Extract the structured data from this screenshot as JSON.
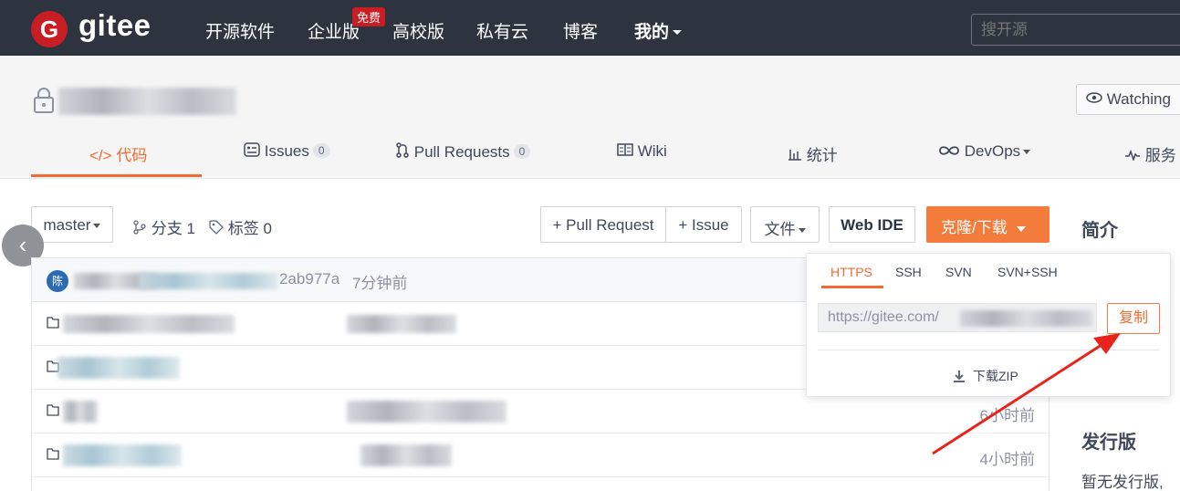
{
  "brand": {
    "logo_letter": "G",
    "name": "gitee",
    "accent": "#c71d23",
    "primary": "#f36b31"
  },
  "topnav": {
    "items": [
      "开源软件",
      "企业版",
      "高校版",
      "私有云",
      "博客",
      "我的"
    ],
    "badge": "免费",
    "search_placeholder": "搜开源"
  },
  "repo": {
    "watch_label": "Watching",
    "tabs": [
      {
        "icon": "code-icon",
        "label": "代码"
      },
      {
        "icon": "issues-icon",
        "label": "Issues",
        "count": "0"
      },
      {
        "icon": "pull-request-icon",
        "label": "Pull Requests",
        "count": "0"
      },
      {
        "icon": "wiki-icon",
        "label": "Wiki"
      },
      {
        "icon": "stats-icon",
        "label": "统计"
      },
      {
        "icon": "devops-icon",
        "label": "DevOps"
      },
      {
        "icon": "service-icon",
        "label": "服务"
      }
    ]
  },
  "toolbar": {
    "branch": "master",
    "branches": "分支 1",
    "tags": "标签 0",
    "pull_request": "+ Pull Request",
    "issue": "+ Issue",
    "file": "文件",
    "web_ide": "Web IDE",
    "clone": "克隆/下载"
  },
  "commit": {
    "avatar_letter": "陈",
    "hash": "2ab977a",
    "time": "7分钟前"
  },
  "files": [
    {
      "time": ""
    },
    {
      "time": ""
    },
    {
      "time": "6小时前"
    },
    {
      "time": "4小时前"
    }
  ],
  "clone_popup": {
    "tabs": [
      "HTTPS",
      "SSH",
      "SVN",
      "SVN+SSH"
    ],
    "url": "https://gitee.com/",
    "copy": "复制",
    "download_zip": "下载ZIP"
  },
  "sidebar": {
    "intro_title": "简介",
    "release_title": "发行版",
    "release_text": "暂无发行版,"
  }
}
